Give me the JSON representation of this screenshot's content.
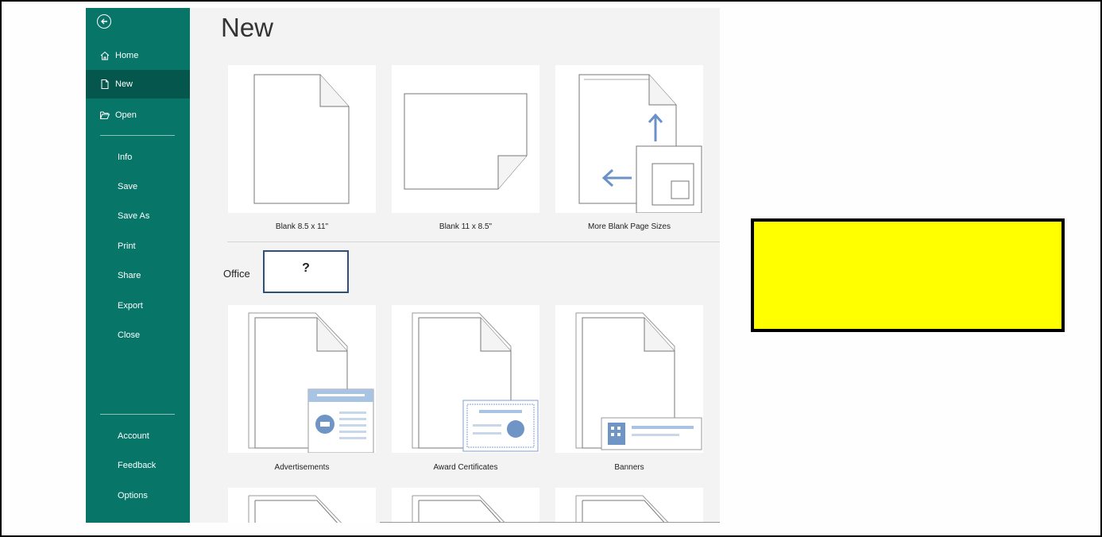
{
  "page_title": "New",
  "sidebar": {
    "top_items": [
      {
        "label": "Home",
        "icon": "home-icon"
      },
      {
        "label": "New",
        "icon": "new-document-icon"
      },
      {
        "label": "Open",
        "icon": "open-folder-icon"
      }
    ],
    "mid_items": [
      "Info",
      "Save",
      "Save As",
      "Print",
      "Share",
      "Export",
      "Close"
    ],
    "bottom_items": [
      "Account",
      "Feedback",
      "Options"
    ],
    "selected": "New"
  },
  "blank_tiles": [
    "Blank 8.5 x 11\"",
    "Blank 11 x 8.5\"",
    "More Blank Page Sizes"
  ],
  "office_label": "Office",
  "search_placeholder_box": "?",
  "template_tiles": [
    "Advertisements",
    "Award Certificates",
    "Banners"
  ],
  "colors": {
    "sidebar": "#077568",
    "sidebar_selected": "#05564c",
    "highlight_box": "#ffff00"
  }
}
